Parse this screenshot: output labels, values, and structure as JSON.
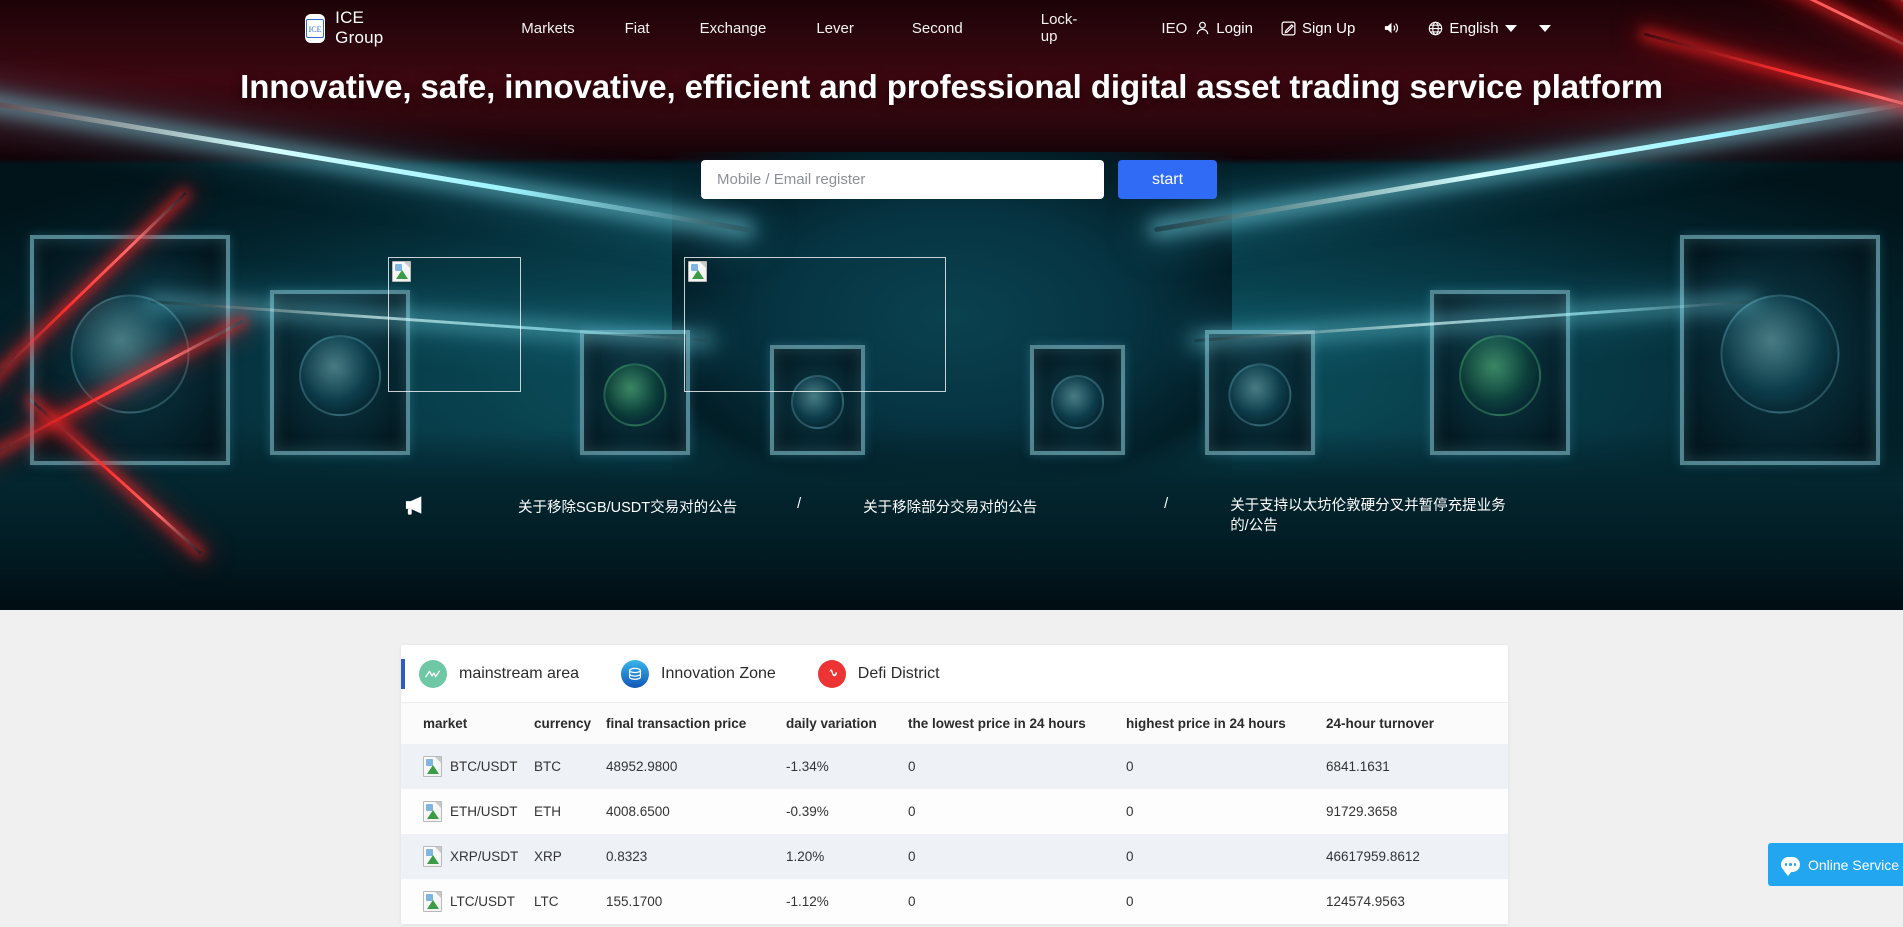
{
  "navbar": {
    "brand": {
      "logo_text": "ICE",
      "name": "ICE Group",
      "logo_icon": "ice-logo-icon"
    },
    "links": [
      {
        "label": "Markets"
      },
      {
        "label": "Fiat"
      },
      {
        "label": "Exchange"
      },
      {
        "label": "Lever"
      },
      {
        "label": "Second"
      },
      {
        "label": "Lock-up"
      },
      {
        "label": "IEO"
      }
    ],
    "login_label": "Login",
    "signup_label": "Sign Up",
    "sound_icon": "speaker-icon",
    "language": {
      "label": "English",
      "globe_icon": "globe-icon"
    }
  },
  "hero": {
    "title": "Innovative, safe, innovative, efficient and professional digital asset trading service platform",
    "register_placeholder": "Mobile / Email register",
    "register_value": "",
    "start_label": "start",
    "accent_blue": "#2F6BF5"
  },
  "announcements": {
    "megaphone_icon": "megaphone-icon",
    "separator": "/",
    "items": [
      {
        "text": "关于移除SGB/USDT交易对的公告"
      },
      {
        "text": "关于移除部分交易对的公告"
      },
      {
        "text": "关于支持以太坊伦敦硬分叉并暂停充提业务的/公告"
      }
    ]
  },
  "market": {
    "tabs": [
      {
        "label": "mainstream area",
        "icon": "mainstream-area-icon",
        "color": "#6ec7a5",
        "glyph": "∿",
        "active": true
      },
      {
        "label": "Innovation Zone",
        "icon": "innovation-zone-icon",
        "color": "#1b84d8",
        "glyph": "☰",
        "active": false
      },
      {
        "label": "Defi District",
        "icon": "defi-district-icon",
        "color": "#ec3434",
        "glyph": "♪",
        "active": false
      }
    ],
    "columns": [
      {
        "key": "market",
        "label": "market"
      },
      {
        "key": "currency",
        "label": "currency"
      },
      {
        "key": "price",
        "label": "final transaction price"
      },
      {
        "key": "change",
        "label": "daily variation"
      },
      {
        "key": "low",
        "label": "the lowest price in 24 hours"
      },
      {
        "key": "high",
        "label": "highest price in 24 hours"
      },
      {
        "key": "turnover",
        "label": "24-hour turnover"
      }
    ],
    "rows": [
      {
        "icon": "broken-image-icon",
        "market": "BTC/USDT",
        "currency": "BTC",
        "price": "48952.9800",
        "change": "-1.34%",
        "low": "0",
        "high": "0",
        "turnover": "6841.1631"
      },
      {
        "icon": "broken-image-icon",
        "market": "ETH/USDT",
        "currency": "ETH",
        "price": "4008.6500",
        "change": "-0.39%",
        "low": "0",
        "high": "0",
        "turnover": "91729.3658"
      },
      {
        "icon": "broken-image-icon",
        "market": "XRP/USDT",
        "currency": "XRP",
        "price": "0.8323",
        "change": "1.20%",
        "low": "0",
        "high": "0",
        "turnover": "46617959.8612"
      },
      {
        "icon": "broken-image-icon",
        "market": "LTC/USDT",
        "currency": "LTC",
        "price": "155.1700",
        "change": "-1.12%",
        "low": "0",
        "high": "0",
        "turnover": "124574.9563"
      }
    ]
  },
  "online_service": {
    "label": "Online Service",
    "icon": "chat-icon",
    "color": "#23A6F0"
  }
}
